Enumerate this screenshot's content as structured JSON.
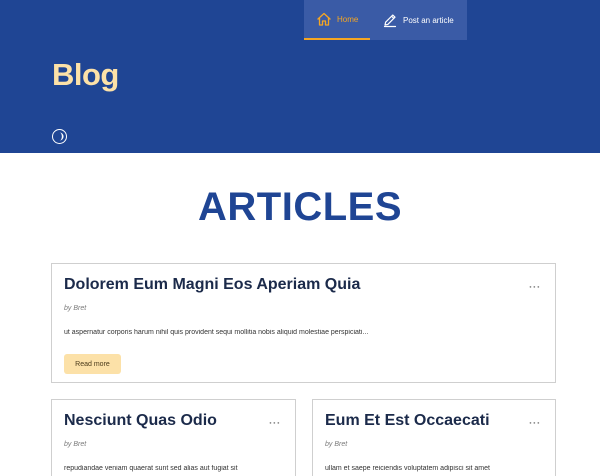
{
  "nav": {
    "home_label": "Home",
    "home_icon": "home-icon",
    "post_label": "Post an article",
    "post_icon": "pencil-icon"
  },
  "header": {
    "title": "Blog",
    "theme_toggle_icon": "half-moon-icon"
  },
  "main": {
    "heading": "ARTICLES",
    "articles": [
      {
        "title": "Dolorem Eum Magni Eos Aperiam Quia",
        "author": "by Bret",
        "excerpt": "ut aspernatur corporis harum nihil quis provident sequi mollitia nobis aliquid molestiae perspiciati...",
        "read_more": "Read more"
      },
      {
        "title": "Nesciunt Quas Odio",
        "author": "by Bret",
        "excerpt": "repudiandae veniam quaerat sunt sed alias aut fugiat sit"
      },
      {
        "title": "Eum Et Est Occaecati",
        "author": "by Bret",
        "excerpt": "ullam et saepe reiciendis voluptatem adipisci sit amet"
      }
    ]
  },
  "colors": {
    "header_bg": "#1f4594",
    "accent": "#f5a623",
    "title_cream": "#fce1a8",
    "heading_blue": "#1f4594"
  }
}
